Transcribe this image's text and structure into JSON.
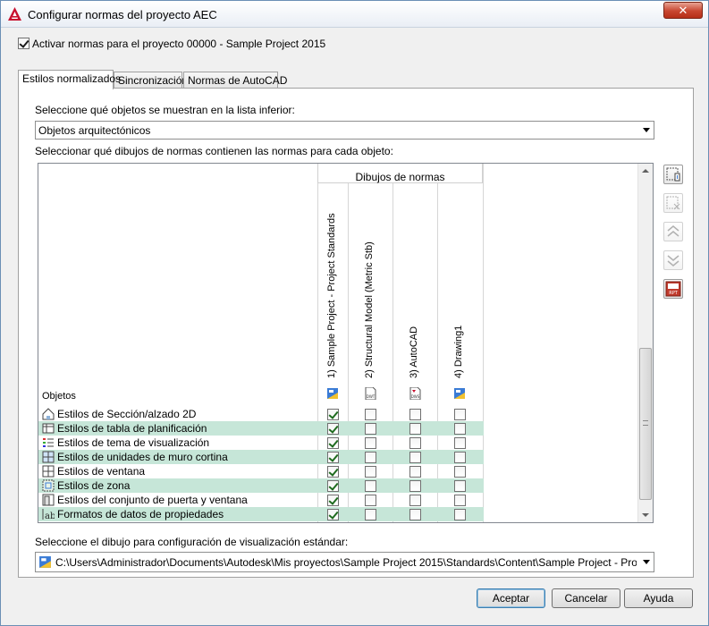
{
  "window": {
    "title": "Configurar normas del proyecto AEC",
    "close_label": "✕"
  },
  "activate": {
    "label": "Activar normas para el proyecto 00000 - Sample Project 2015",
    "checked": true
  },
  "tabs": [
    {
      "label": "Estilos normalizados",
      "active": true
    },
    {
      "label": "Sincronización",
      "active": false
    },
    {
      "label": "Normas de AutoCAD",
      "active": false
    }
  ],
  "objects_filter": {
    "label": "Seleccione qué objetos se muestran en la lista inferior:",
    "value": "Objetos arquitectónicos"
  },
  "grid_intro": "Seleccionar qué dibujos de normas contienen las normas para cada objeto:",
  "grid": {
    "objects_header": "Objetos",
    "group_header": "Dibujos de normas",
    "drawings": [
      {
        "label": "1) Sample Project - Project Standards",
        "icon": "dwg-blueprint-icon"
      },
      {
        "label": "2) Structural Model (Metric Stb)",
        "icon": "dwt-file-icon"
      },
      {
        "label": "3) AutoCAD",
        "icon": "dws-file-icon"
      },
      {
        "label": "4) Drawing1",
        "icon": "dwg-blueprint-icon"
      }
    ],
    "rows": [
      {
        "label": "Estilos de Sección/alzado 2D",
        "icon": "section-elevation-icon",
        "checks": [
          true,
          false,
          false,
          false
        ]
      },
      {
        "label": "Estilos de tabla de planificación",
        "icon": "schedule-table-icon",
        "checks": [
          true,
          false,
          false,
          false
        ]
      },
      {
        "label": "Estilos de tema de visualización",
        "icon": "display-theme-icon",
        "checks": [
          true,
          false,
          false,
          false
        ]
      },
      {
        "label": "Estilos de unidades de muro cortina",
        "icon": "curtain-wall-unit-icon",
        "checks": [
          true,
          false,
          false,
          false
        ]
      },
      {
        "label": "Estilos de ventana",
        "icon": "window-icon",
        "checks": [
          true,
          false,
          false,
          false
        ]
      },
      {
        "label": "Estilos de zona",
        "icon": "zone-icon",
        "checks": [
          true,
          false,
          false,
          false
        ]
      },
      {
        "label": "Estilos del conjunto de puerta y ventana",
        "icon": "door-window-assembly-icon",
        "checks": [
          true,
          false,
          false,
          false
        ]
      },
      {
        "label": "Formatos de datos de propiedades",
        "icon": "property-data-format-icon",
        "checks": [
          true,
          false,
          false,
          false
        ]
      }
    ]
  },
  "side_buttons": [
    {
      "name": "add-drawing-button",
      "icon": "add-drawing-icon",
      "enabled": true
    },
    {
      "name": "remove-drawing-button",
      "icon": "remove-drawing-icon",
      "enabled": false
    },
    {
      "name": "move-up-button",
      "icon": "double-chevron-up-icon",
      "enabled": false
    },
    {
      "name": "move-down-button",
      "icon": "double-chevron-down-icon",
      "enabled": false
    },
    {
      "name": "report-button",
      "icon": "rpt-report-icon",
      "enabled": true,
      "text": "RPT"
    }
  ],
  "display_config": {
    "label": "Seleccione el dibujo para configuración de visualización estándar:",
    "value": "C:\\Users\\Administrador\\Documents\\Autodesk\\Mis proyectos\\Sample Project 2015\\Standards\\Content\\Sample Project - Project Standards"
  },
  "buttons": {
    "ok": "Aceptar",
    "cancel": "Cancelar",
    "help": "Ayuda"
  },
  "colors": {
    "row_alt": "#c6e6d8",
    "check_green": "#1e6b1e",
    "title_gradient_end": "#e9eef5"
  }
}
